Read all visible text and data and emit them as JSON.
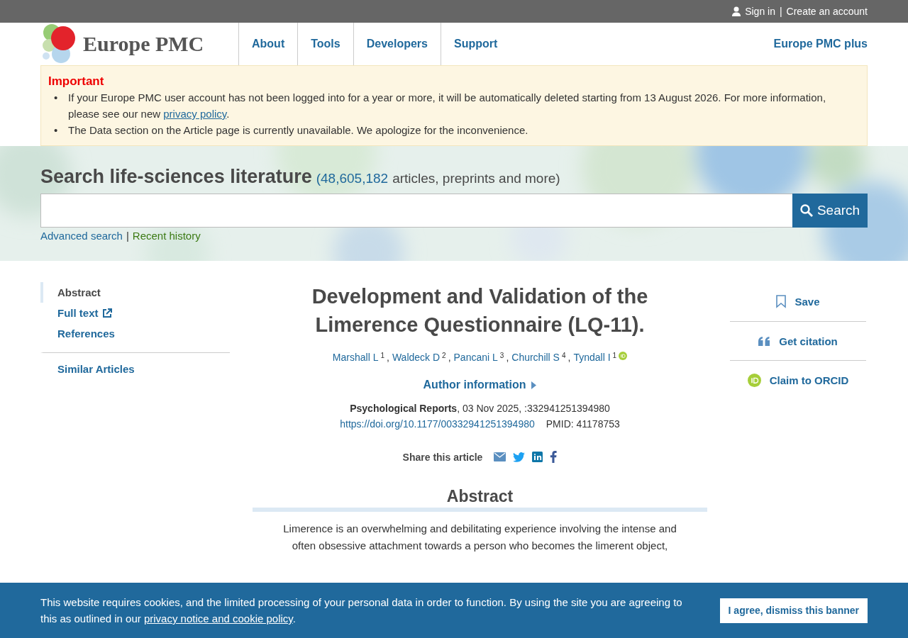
{
  "top_bar": {
    "sign_in": "Sign in",
    "separator": "|",
    "create_account": "Create an account"
  },
  "header": {
    "logo_text": "Europe PMC",
    "nav": [
      "About",
      "Tools",
      "Developers",
      "Support"
    ],
    "plus_link": "Europe PMC plus"
  },
  "notice": {
    "title": "Important",
    "items": [
      {
        "marker": "•",
        "text": "If your Europe PMC user account has not been logged into for a year or more, it will be automatically deleted starting from 13 August 2026. For more information,",
        "text2": "please see our new ",
        "link": "privacy policy",
        "after": "."
      },
      {
        "marker": "•",
        "text": "The Data section on the Article page is currently unavailable. We apologize for the inconvenience."
      }
    ]
  },
  "search": {
    "heading": "Search life-sciences literature",
    "count": "(48,605,182",
    "count_suffix": "articles, preprints and more)",
    "button": "Search",
    "links": [
      {
        "label": "Advanced search",
        "kind": "link"
      },
      {
        "label": "|",
        "kind": "separator"
      },
      {
        "label": "Recent history",
        "kind": "history"
      }
    ]
  },
  "sidebar": {
    "items": [
      {
        "label": "Abstract",
        "selected": true,
        "external": false,
        "divider_before": false
      },
      {
        "label": "Full text",
        "selected": false,
        "external": true,
        "divider_before": false
      },
      {
        "label": "References",
        "selected": false,
        "external": false,
        "divider_before": false
      },
      {
        "label": "Similar Articles",
        "selected": false,
        "external": false,
        "divider_before": true
      }
    ]
  },
  "article": {
    "title": "Development and Validation of the Limerence Questionnaire (LQ-11).",
    "authors": [
      {
        "name": "Marshall L",
        "affiliation": "1",
        "suffix": ",",
        "orcid": false
      },
      {
        "name": "Waldeck D",
        "affiliation": "2",
        "suffix": ",",
        "orcid": false
      },
      {
        "name": "Pancani L",
        "affiliation": "3",
        "suffix": ",",
        "orcid": false
      },
      {
        "name": "Churchill S",
        "affiliation": "4",
        "suffix": ",",
        "orcid": false
      },
      {
        "name": "Tyndall I",
        "affiliation": "1",
        "orcid": true
      }
    ],
    "author_info": "Author information",
    "expanded": false,
    "journal": "Psychological Reports",
    "citation": ", 03 Nov 2025, :332941251394980",
    "doi": "https://doi.org/10.1177/00332941251394980",
    "pmid": "PMID: 41178753",
    "share_label": "Share this article",
    "abstract_heading": "Abstract",
    "abstract_lines": [
      "Limerence is an overwhelming and debilitating experience involving the intense and",
      "often obsessive attachment towards a person who becomes the limerent object,"
    ]
  },
  "actions": [
    {
      "label": "Save",
      "kind": "save"
    },
    {
      "label": "Get citation",
      "kind": "cite"
    },
    {
      "label": "Claim to ORCID",
      "kind": "orcid"
    }
  ],
  "cookie_banner": {
    "text": "This website requires cookies, and the limited processing of your personal data in order to function. By using the site you are agreeing to this as outlined in our ",
    "link": "privacy notice and cookie policy",
    "after": ".",
    "button": "I agree, dismiss this banner"
  }
}
